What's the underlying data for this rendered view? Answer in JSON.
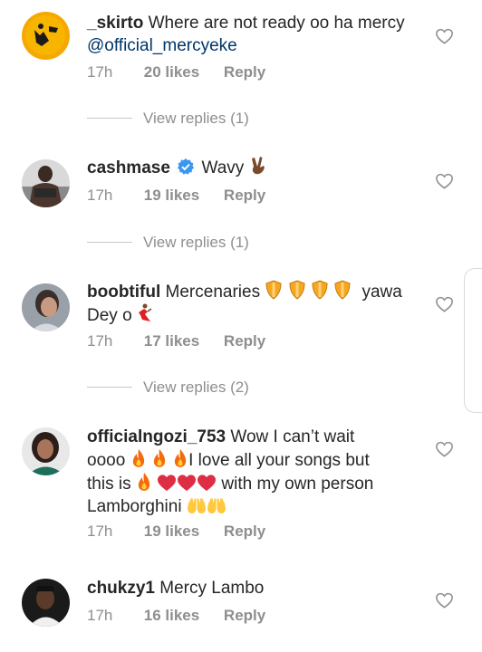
{
  "comments": [
    {
      "username": "_skirto",
      "text": "Where are not ready oo ha mercy",
      "mention": "@official_mercyeke",
      "time": "17h",
      "likes": "20 likes",
      "reply": "Reply",
      "view_replies": "View replies (1)"
    },
    {
      "username": "cashmase",
      "text": "Wavy",
      "time": "17h",
      "likes": "19 likes",
      "reply": "Reply",
      "view_replies": "View replies (1)",
      "verified": true
    },
    {
      "username": "boobtiful",
      "text_a": "Mercenaries",
      "text_b": "yawa",
      "text_c": "Dey o",
      "time": "17h",
      "likes": "17 likes",
      "reply": "Reply",
      "view_replies": "View replies (2)"
    },
    {
      "username": "officialngozi_753",
      "text_a": "Wow I can’t wait",
      "text_b": "oooo",
      "text_c": "I love all your songs but",
      "text_d": "this is",
      "text_e": "with my own person",
      "text_f": "Lamborghini",
      "time": "17h",
      "likes": "19 likes",
      "reply": "Reply"
    },
    {
      "username": "chukzy1",
      "text": "Mercy Lambo",
      "time": "17h",
      "likes": "16 likes",
      "reply": "Reply"
    }
  ],
  "colors": {
    "text": "#262626",
    "meta": "#8e8e8e",
    "mention": "#003569",
    "verified": "#3897f0"
  },
  "icons": [
    "heart-outline-icon",
    "verified-badge-icon",
    "victory-hand-emoji",
    "shield-emoji",
    "dancer-emoji",
    "fire-emoji",
    "red-heart-emoji",
    "raised-hands-emoji"
  ]
}
